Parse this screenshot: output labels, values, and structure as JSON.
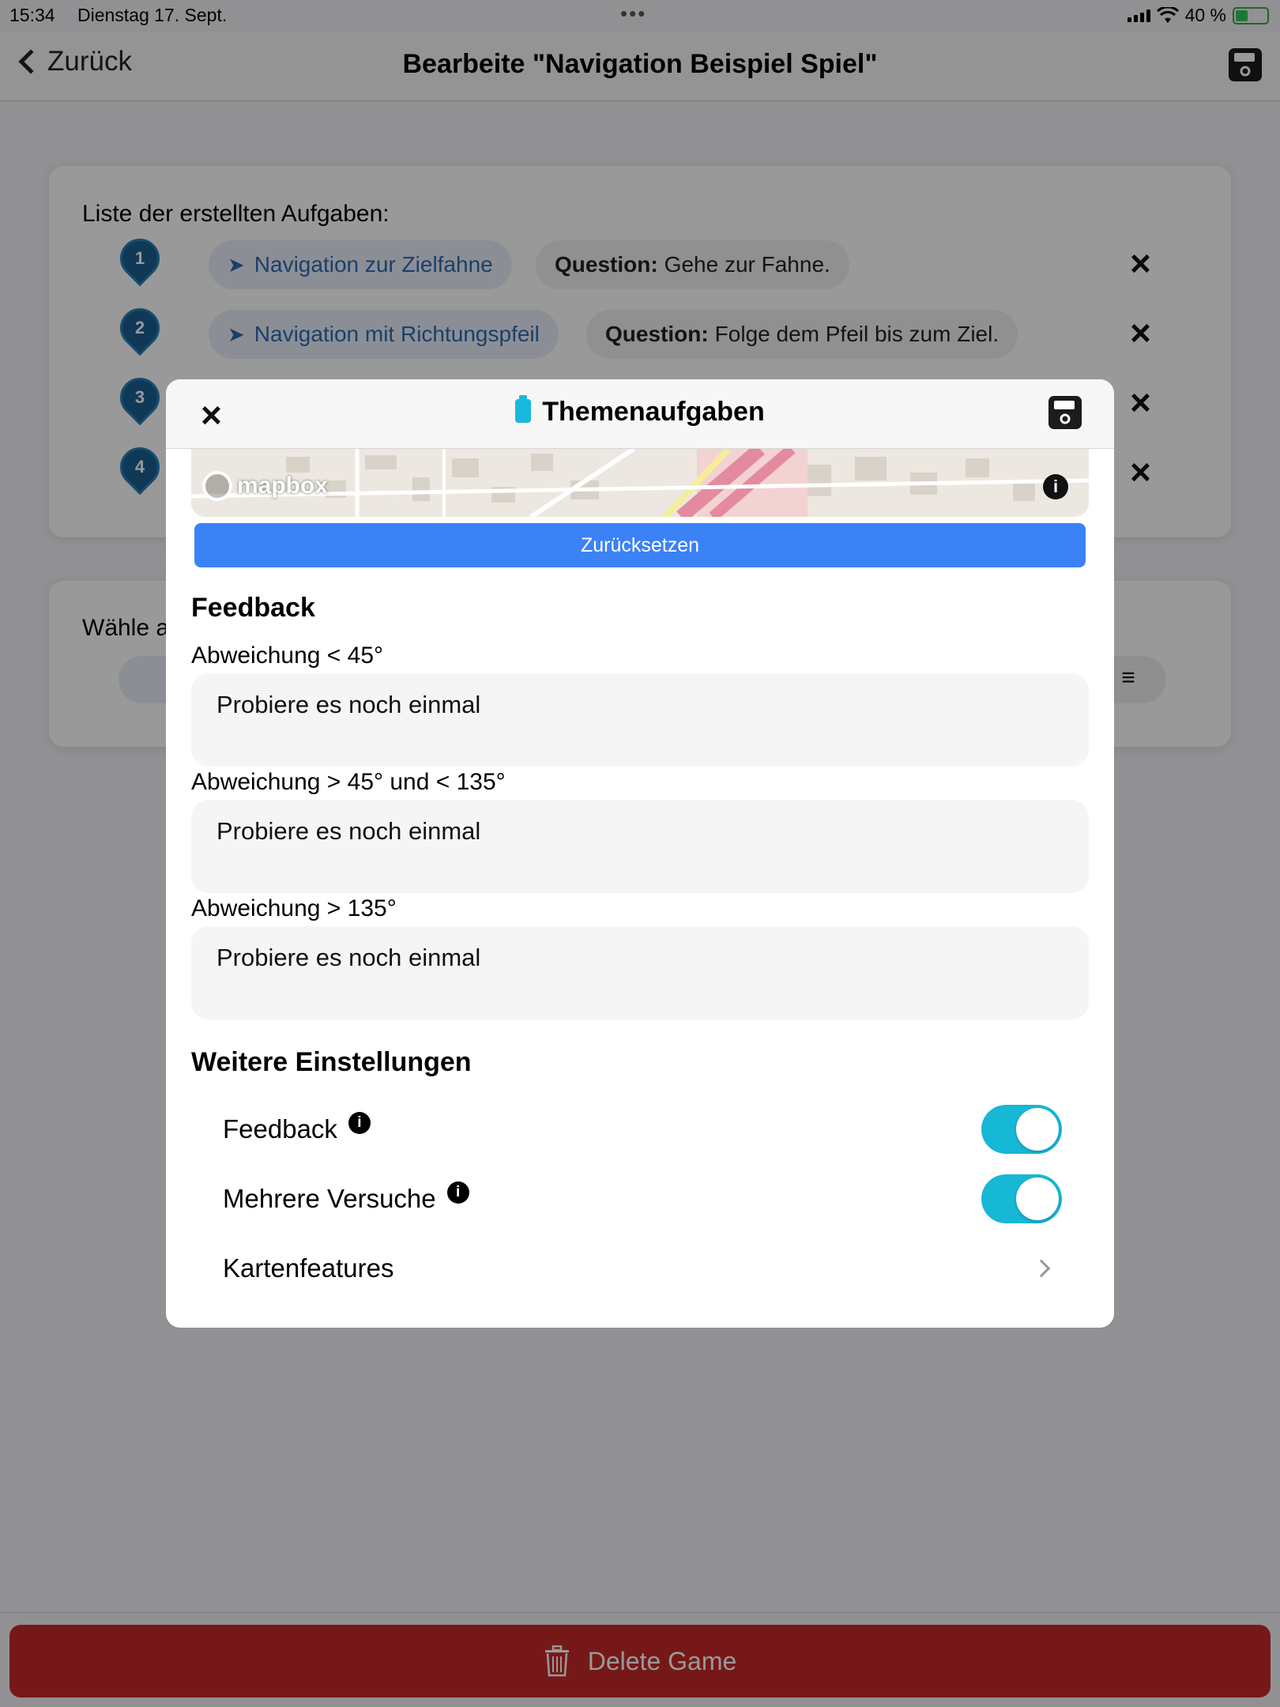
{
  "status": {
    "time": "15:34",
    "date": "Dienstag 17. Sept.",
    "dots": "•••",
    "battery": "40 %",
    "battery_level": 0.4
  },
  "nav": {
    "back_label": "Zurück",
    "title": "Bearbeite \"Navigation Beispiel Spiel\""
  },
  "tasks": {
    "title": "Liste der erstellten Aufgaben:",
    "items": [
      {
        "number": "1",
        "type": "Navigation zur Zielfahne",
        "question_label": "Question:",
        "question": "Gehe zur Fahne."
      },
      {
        "number": "2",
        "type": "Navigation mit Richtungspfeil",
        "question_label": "Question:",
        "question": "Folge dem Pfeil bis zum Ziel."
      },
      {
        "number": "3"
      },
      {
        "number": "4"
      }
    ],
    "remove_icon": "×"
  },
  "choose": {
    "label": "Wähle a",
    "menu_icon": "≡"
  },
  "delete_label": "Delete Game",
  "modal": {
    "title": "Themenaufgaben",
    "close_icon": "×",
    "map": {
      "attribution": "mapbox",
      "info_icon": "i"
    },
    "reset_label": "Zurücksetzen",
    "feedback_title": "Feedback",
    "feedback_fields": [
      {
        "label": "Abweichung < 45°",
        "value": "Probiere es noch einmal"
      },
      {
        "label": "Abweichung > 45° und < 135°",
        "value": "Probiere es noch einmal"
      },
      {
        "label": "Abweichung > 135°",
        "value": "Probiere es noch einmal"
      }
    ],
    "settings_title": "Weitere Einstellungen",
    "settings": [
      {
        "label": "Feedback",
        "info_icon": "i",
        "on": true
      },
      {
        "label": "Mehrere Versuche",
        "info_icon": "i",
        "on": true
      },
      {
        "label": "Kartenfeatures"
      }
    ]
  },
  "colors": {
    "accent": "#17b7d6",
    "primary_button": "#3b82f6",
    "danger": "#c62828",
    "marker": "#1a5f8f"
  }
}
